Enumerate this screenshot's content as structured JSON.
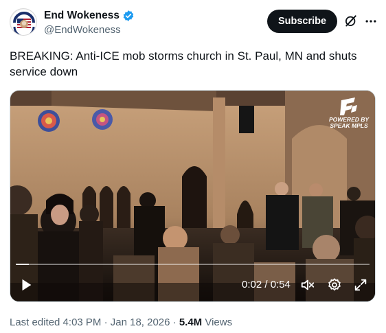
{
  "account": {
    "display_name": "End Wokeness",
    "handle": "@EndWokeness",
    "avatar_text_top": "I SUPPORT ICE",
    "avatar_text_bottom": "PROTECT OUR BORDERS"
  },
  "actions": {
    "subscribe_label": "Subscribe"
  },
  "tweet": {
    "text": "BREAKING: Anti-ICE mob storms church in St. Paul, MN and shuts service down"
  },
  "video": {
    "watermark_line1": "POWERED BY",
    "watermark_line2": "SPEAK MPLS",
    "time_display": "0:02 / 0:54",
    "progress_fraction": 0.037
  },
  "footer": {
    "edited": "Last edited 4:03 PM · Jan 18, 2026 ·",
    "views_count": "5.4M",
    "views_label": "Views"
  },
  "colors": {
    "accent": "#1d9bf0",
    "subscribe_bg": "#0f1419",
    "secondary_text": "#536471"
  },
  "icons": [
    "verified-badge-icon",
    "grok-icon",
    "more-icon",
    "play-icon",
    "mute-icon",
    "settings-icon",
    "fullscreen-icon"
  ]
}
